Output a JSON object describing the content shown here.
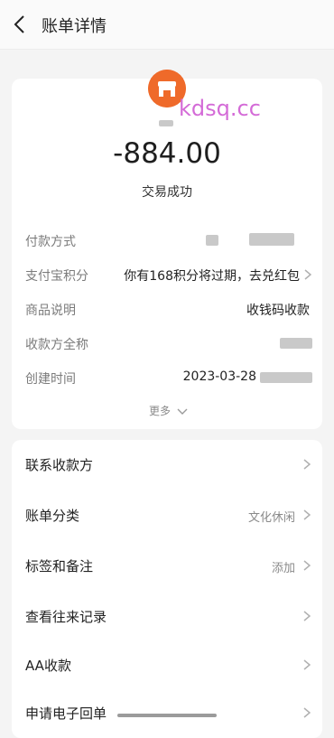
{
  "header": {
    "title": "账单详情"
  },
  "merchant": {
    "icon": "shop-icon",
    "watermark": "kdsq.cc"
  },
  "transaction": {
    "amount": "-884.00",
    "status": "交易成功"
  },
  "details": {
    "rows": [
      {
        "label": "付款方式",
        "value": ""
      },
      {
        "label": "支付宝积分",
        "value": "你有168积分将过期，去兑红包"
      },
      {
        "label": "商品说明",
        "value": "收钱码收款"
      },
      {
        "label": "收款方全称",
        "value": ""
      },
      {
        "label": "创建时间",
        "value": "2023-03-28"
      }
    ],
    "more": "更多"
  },
  "actions": [
    {
      "label": "联系收款方",
      "value": ""
    },
    {
      "label": "账单分类",
      "value": "文化休闲"
    },
    {
      "label": "标签和备注",
      "value": "添加"
    },
    {
      "label": "查看往来记录",
      "value": ""
    },
    {
      "label": "AA收款",
      "value": ""
    },
    {
      "label": "申请电子回单",
      "value": ""
    }
  ],
  "colors": {
    "accent": "#ef6a2a",
    "watermark": "#d46bd7"
  }
}
